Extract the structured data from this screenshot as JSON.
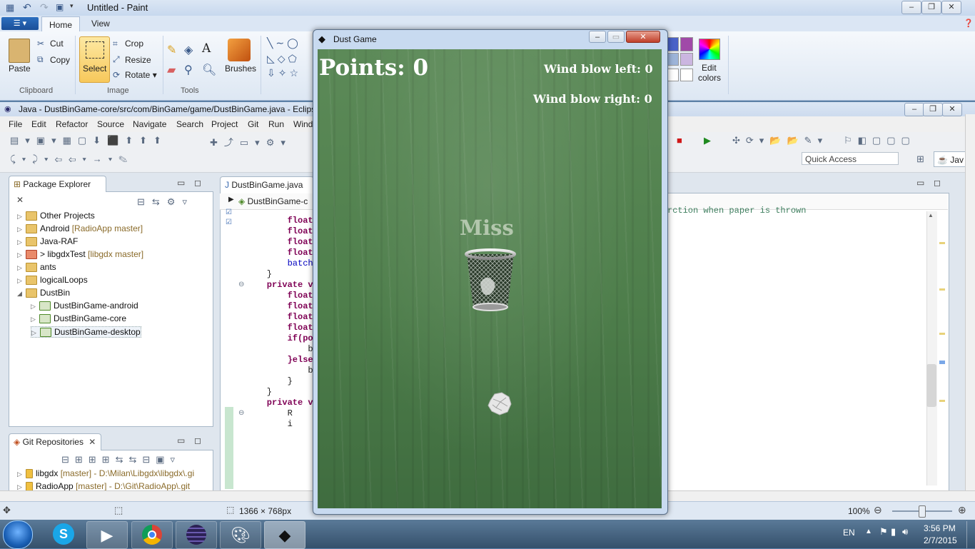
{
  "paint": {
    "title": "Untitled - Paint",
    "tabs": {
      "file": "☰ ▾",
      "home": "Home",
      "view": "View"
    },
    "clipboard": {
      "paste": "Paste",
      "cut": "Cut",
      "copy": "Copy",
      "group": "Clipboard"
    },
    "image": {
      "select": "Select",
      "crop": "Crop",
      "resize": "Resize",
      "rotate": "Rotate ▾",
      "group": "Image"
    },
    "tools": {
      "group": "Tools",
      "brushes": "Brushes"
    },
    "colors": {
      "edit_colors_1": "Edit",
      "edit_colors_2": "colors"
    },
    "status": {
      "dimensions": "1366 × 768px",
      "zoom": "100%"
    }
  },
  "eclipse": {
    "title": "Java - DustBinGame-core/src/com/BinGame/game/DustBinGame.java - Eclips",
    "menu": [
      "File",
      "Edit",
      "Refactor",
      "Source",
      "Navigate",
      "Search",
      "Project",
      "Git",
      "Run",
      "Windo"
    ],
    "quick_access": "Quick Access",
    "perspective": "Jav",
    "package_explorer": {
      "tab": "Package Explorer",
      "items": [
        {
          "label": "Other Projects",
          "decor": ""
        },
        {
          "label": "Android",
          "decor": "[RadioApp master]"
        },
        {
          "label": "Java-RAF",
          "decor": ""
        },
        {
          "label": "> libgdxTest",
          "decor": "[libgdx master]"
        },
        {
          "label": "ants",
          "decor": ""
        },
        {
          "label": "logicalLoops",
          "decor": ""
        },
        {
          "label": "DustBin",
          "decor": ""
        },
        {
          "label": "DustBinGame-android",
          "decor": ""
        },
        {
          "label": "DustBinGame-core",
          "decor": ""
        },
        {
          "label": "DustBinGame-desktop",
          "decor": ""
        }
      ]
    },
    "git_repositories": {
      "tab": "Git Repositories",
      "items": [
        {
          "label": "libgdx",
          "decor": "[master] - D:\\Milan\\Libgdx\\libgdx\\.gi"
        },
        {
          "label": "RadioApp",
          "decor": "[master] - D:\\Git\\RadioApp\\.git"
        }
      ]
    },
    "editor": {
      "tab": "DustBinGame.java",
      "breadcrumb": "DustBinGame-c",
      "right_fragment": "rction when paper is thrown",
      "lines": [
        "        float",
        "        float",
        "        float",
        "        float",
        "        batch",
        "    }",
        "",
        "    private v",
        "        float",
        "        float",
        "        float",
        "        float",
        "        if(po",
        "            b",
        "        }else",
        "            b",
        "        }",
        "    }",
        "",
        "    private v",
        "        R",
        "        i"
      ]
    }
  },
  "game": {
    "window_title": "Dust Game",
    "points_label": "Points: 0",
    "wind_left": "Wind blow left: 0",
    "wind_right": "Wind blow right: 0",
    "result_text": "Miss"
  },
  "taskbar": {
    "language": "EN",
    "time": "3:56 PM",
    "date": "2/7/2015"
  }
}
